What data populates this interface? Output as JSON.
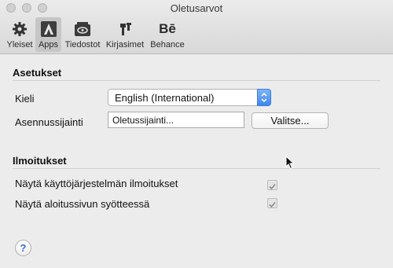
{
  "window": {
    "title": "Oletusarvot"
  },
  "toolbar": {
    "items": [
      {
        "label": "Yleiset",
        "icon": "gear-icon"
      },
      {
        "label": "Apps",
        "icon": "adobe-apps-icon",
        "active": true
      },
      {
        "label": "Tiedostot",
        "icon": "files-icon"
      },
      {
        "label": "Kirjasimet",
        "icon": "fonts-icon"
      },
      {
        "label": "Behance",
        "icon": "behance-icon",
        "icon_text": "Bē"
      }
    ]
  },
  "settings": {
    "heading": "Asetukset",
    "language_label": "Kieli",
    "language_value": "English (International)",
    "install_location_label": "Asennussijainti",
    "install_location_value": "Oletussijainti...",
    "choose_button": "Valitse..."
  },
  "notifications": {
    "heading": "Ilmoitukset",
    "items": [
      {
        "label": "Näytä käyttöjärjestelmän ilmoitukset",
        "checked": true
      },
      {
        "label": "Näytä aloitussivun syötteessä",
        "checked": true
      }
    ]
  },
  "help": {
    "symbol": "?"
  },
  "colors": {
    "accent": "#3f87ee",
    "background": "#ececec"
  }
}
